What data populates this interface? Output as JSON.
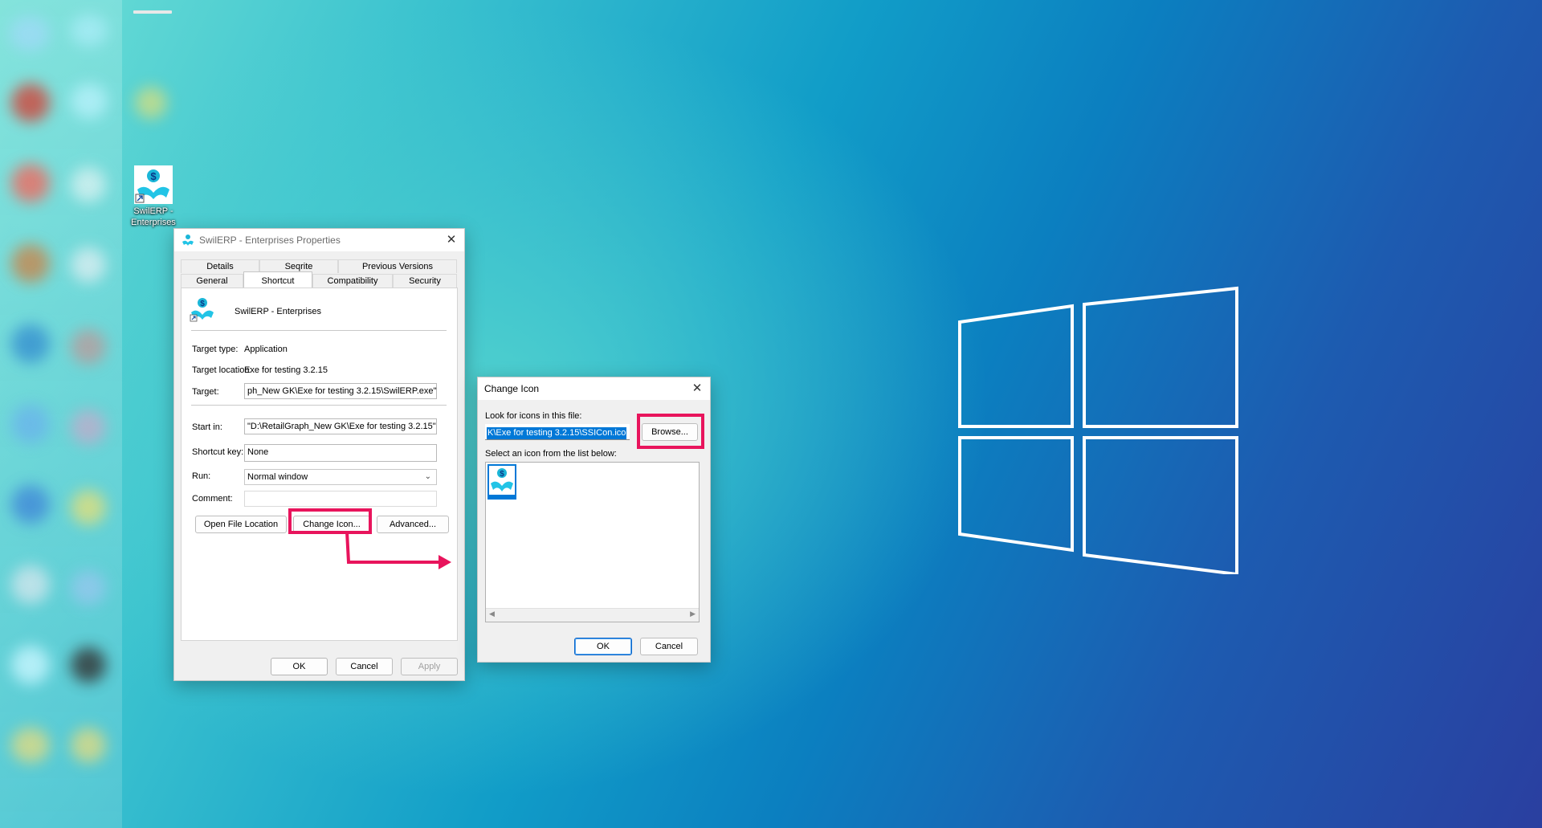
{
  "desktop": {
    "shortcut_label_line1": "SwilERP -",
    "shortcut_label_line2": "Enterprises"
  },
  "properties": {
    "title": "SwilERP - Enterprises Properties",
    "tabs_top": [
      "Details",
      "Seqrite",
      "Previous Versions"
    ],
    "tabs_bottom": [
      "General",
      "Shortcut",
      "Compatibility",
      "Security"
    ],
    "app_name": "SwilERP - Enterprises",
    "target_type_label": "Target type:",
    "target_type_value": "Application",
    "target_location_label": "Target location:",
    "target_location_value": "Exe for testing 3.2.15",
    "target_label": "Target:",
    "target_value": "ph_New GK\\Exe for testing 3.2.15\\SwilERP.exe\"",
    "start_in_label": "Start in:",
    "start_in_value": "\"D:\\RetailGraph_New GK\\Exe for testing 3.2.15\"",
    "shortcut_key_label": "Shortcut key:",
    "shortcut_key_value": "None",
    "run_label": "Run:",
    "run_value": "Normal window",
    "comment_label": "Comment:",
    "comment_value": "",
    "open_file_location": "Open File Location",
    "change_icon": "Change Icon...",
    "advanced": "Advanced...",
    "ok": "OK",
    "cancel": "Cancel",
    "apply": "Apply"
  },
  "change_icon": {
    "title": "Change Icon",
    "look_label": "Look for icons in this file:",
    "file_value": "K\\Exe for testing 3.2.15\\SSICon.ico",
    "browse": "Browse...",
    "select_label": "Select an icon from the list below:",
    "ok": "OK",
    "cancel": "Cancel"
  },
  "colors": {
    "highlight": "#e8145c",
    "selection": "#0078d7",
    "accent": "#0a64c8"
  }
}
